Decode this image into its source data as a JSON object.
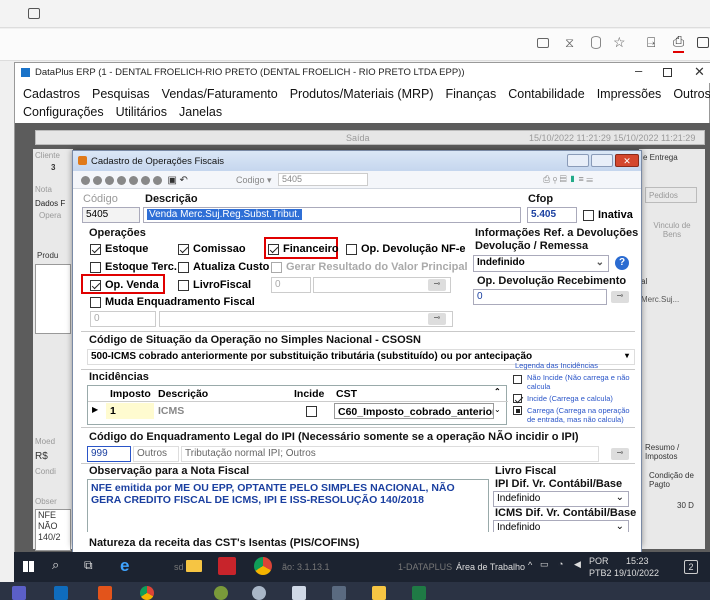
{
  "browser": {
    "tab_placeholder": "",
    "toolbar_icons": [
      "cast-icon",
      "hourglass-icon",
      "database-icon",
      "star-icon",
      "download-icon",
      "bookmark-icon",
      "panel-icon"
    ]
  },
  "main_window": {
    "title": "DataPlus ERP (1 - DENTAL FROELICH-RIO PRETO  (DENTAL FROELICH - RIO PRETO LTDA EPP))",
    "menu_row1": [
      "Cadastros",
      "Pesquisas",
      "Vendas/Faturamento",
      "Produtos/Materiais (MRP)",
      "Finanças",
      "Contabilidade",
      "Impressões",
      "Outros"
    ],
    "menu_row2": [
      "Configurações",
      "Utilitários",
      "Janelas"
    ]
  },
  "background": {
    "saida": "Saída",
    "dates": "15/10/2022   11:21:29   15/10/2022   11:21:29",
    "cliente": "Cliente",
    "nota": "Nota",
    "dados": "Dados F",
    "opera": "Opera",
    "produ": "Produ",
    "entrega": "e Entrega",
    "pedidos": "Pedidos",
    "vinculo": "Vinculo de Bens",
    "al": "al",
    "merc_suj": "Merc.Suj...",
    "moed": "Moed",
    "rs": "R$",
    "cond": "Condi",
    "obser": "Obser",
    "nfe_lines": [
      "NFE",
      "NÃO",
      "140/2"
    ],
    "resumo": "Resumo / Impostos",
    "condicao": "Condição de Pagto",
    "thirty": "30 D",
    "prefix_3": "3"
  },
  "dialog": {
    "title": "Cadastro de Operações Fiscais",
    "codigo_label": "Codigo",
    "codigo_value": "5405",
    "fields": {
      "codigo_header": "Código",
      "descricao_header": "Descrição",
      "cfop_header": "Cfop",
      "codigo": "5405",
      "descricao": "Venda Merc.Suj.Reg.Subst.Tribut.",
      "cfop": "5.405",
      "inativa": "Inativa"
    },
    "operacoes": {
      "title": "Operações",
      "estoque": "Estoque",
      "comissao": "Comissao",
      "financeiro": "Financeiro",
      "devolucao_nfe": "Op. Devolução NF-e",
      "estoque_terc": "Estoque Terc.",
      "atualiza_custo": "Atualiza Custo",
      "gerar_resultado": "Gerar Resultado do Valor Principal",
      "op_venda": "Op. Venda",
      "livro_fiscal": "LivroFiscal",
      "livro_value": "0",
      "muda_enquadramento": "Muda Enquadramento Fiscal",
      "muda_value": "0"
    },
    "ref_devolucoes": {
      "title1": "Informações Ref. a Devoluções",
      "title2": "Devolução / Remessa",
      "select": "Indefinido",
      "recebimento_title": "Op. Devolução Recebimento",
      "recebimento_value": "0"
    },
    "csosn": {
      "title": "Código de Situação da Operação no Simples Nacional - CSOSN",
      "value": "500-ICMS cobrado anteriormente por substituição tributária (substituído) ou por antecipação"
    },
    "incidencias": {
      "title": "Incidências",
      "headers": [
        "Imposto",
        "Descrição",
        "Incide",
        "CST"
      ],
      "row": {
        "imposto": "1",
        "descricao": "ICMS",
        "cst": "C60_Imposto_cobrado_anteriormen"
      }
    },
    "legenda": {
      "title": "Legenda das Incidências",
      "items": [
        "Não Incide (Não carrega e não calcula",
        "Incide (Carrega e calcula)",
        "Carrega (Carrega na operação de entrada, mas não calcula)"
      ]
    },
    "ipi": {
      "title": "Código do Enquadramento Legal do IPI (Necessário somente se a operação NÃO incidir o IPI)",
      "code": "999",
      "group": "Outros",
      "desc": "Tributação normal IPI; Outros"
    },
    "observacao": {
      "title": "Observação para a Nota Fiscal",
      "text": "NFE emitida por ME OU EPP, OPTANTE PELO SIMPLES NACIONAL, NÃO GERA CREDITO FISCAL DE ICMS, IPI E ISS-RESOLUÇÃO 140/2018"
    },
    "livro_fiscal": {
      "title": "Livro Fiscal",
      "ipi_label": "IPI Dif. Vr. Contábil/Base",
      "ipi_value": "Indefinido",
      "icms_label": "ICMS Dif. Vr. Contábil/Base",
      "icms_value": "Indefinido"
    },
    "natureza": "Natureza da receita das CST's Isentas (PIS/COFINS)"
  },
  "taskbar_inner": {
    "left": "sd",
    "version": "ão: 3.1.13.1",
    "datap": "1-DATAPLUS",
    "area": "Área de Trabalho",
    "lang1": "POR",
    "lang2": "PTB2",
    "time": "15:23",
    "date": "19/10/2022",
    "badge": "2"
  },
  "colors": {
    "accent_red": "#e00000",
    "title_blue": "#0b3fa8",
    "selection_blue": "#2f6fd6"
  }
}
